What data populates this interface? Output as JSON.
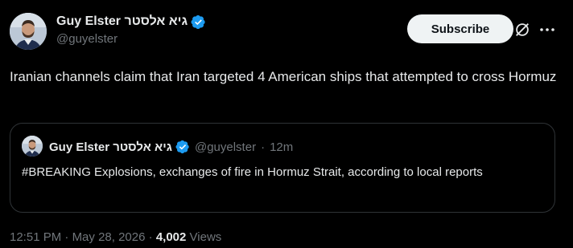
{
  "author": {
    "display_name": "Guy Elster גיא אלסטר",
    "handle": "@guyelster",
    "verified": true
  },
  "header": {
    "subscribe_label": "Subscribe",
    "grok_icon": "grok-slash-circle-icon",
    "more_icon": "more-dots-icon"
  },
  "tweet": {
    "text": "Iranian channels claim that Iran targeted 4 American ships that attempted to cross Hormuz"
  },
  "quote": {
    "display_name": "Guy Elster גיא אלסטר",
    "handle": "@guyelster",
    "separator": "·",
    "age": "12m",
    "text": "#BREAKING Explosions, exchanges of fire in Hormuz Strait, according to local reports"
  },
  "footer": {
    "time": "12:51 PM",
    "separator": "·",
    "date": "May 28, 2026",
    "views_count": "4,002",
    "views_label": "Views"
  },
  "colors": {
    "background": "#000000",
    "text": "#e7e9ea",
    "muted": "#71767b",
    "verified_blue": "#1d9bf0",
    "border": "#2f3336"
  }
}
